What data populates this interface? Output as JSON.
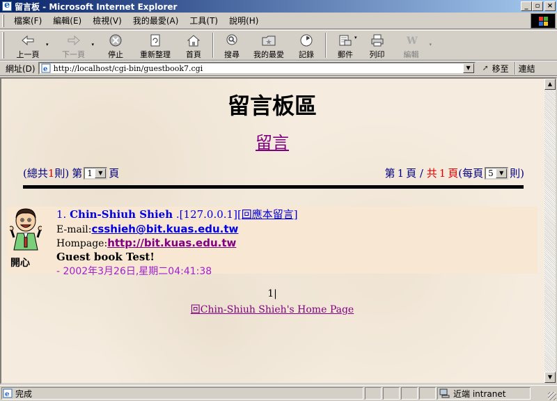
{
  "window": {
    "title": "留言板 - Microsoft Internet Explorer",
    "min_glyph": "_",
    "max_glyph": "▫",
    "close_glyph": "×"
  },
  "menu": [
    "檔案(F)",
    "編輯(E)",
    "檢視(V)",
    "我的最愛(A)",
    "工具(T)",
    "說明(H)"
  ],
  "toolbar": {
    "back": "上一頁",
    "forward": "下一頁",
    "stop": "停止",
    "refresh": "重新整理",
    "home": "首頁",
    "search": "搜尋",
    "favorites": "我的最愛",
    "history": "記錄",
    "mail": "郵件",
    "print": "列印",
    "edit": "編輯",
    "dropdown_glyph": "▾"
  },
  "address": {
    "label": "網址(D)",
    "url": "http://localhost/cgi-bin/guestbook7.cgi",
    "go": "移至",
    "links": "連結",
    "dropdown_glyph": "▼"
  },
  "page": {
    "heading": "留言板區",
    "post_link": "留言",
    "pager_left": {
      "prefix": "(總共",
      "total": "1",
      "suffix": "則)",
      "page_label": "第",
      "page_value": "1",
      "page_unit": "頁"
    },
    "pager_right": {
      "prefix": "第",
      "current": "1",
      "mid": "頁 / ",
      "total_prefix": "共",
      "total": "1",
      "total_unit": "頁",
      "per_prefix": "(每頁",
      "per_value": "5",
      "per_unit": "則)"
    },
    "entry": {
      "number": "1.",
      "author": "Chin-Shiuh Shieh",
      "ip": ".[127.0.0.1]",
      "reply": "[回應本留言]",
      "email_label": "E-mail:",
      "email": "csshieh@bit.kuas.edu.tw",
      "homepage_label": "Hompage:",
      "homepage": "http://bit.kuas.edu.tw",
      "message": "Guest book Test!",
      "date": "- 2002年3月26日,星期二04:41:38",
      "mood": "開心"
    },
    "page_numbers": "1|",
    "home_link": "回Chin-Shiuh Shieh's Home Page"
  },
  "status": {
    "text": "完成",
    "zone": "近端 intranet"
  },
  "scrollbar": {
    "up_glyph": "▲",
    "down_glyph": "▼"
  },
  "colors": {
    "title_start": "#0a246a",
    "title_end": "#a6caf0",
    "page_bg": "#f5ecdf",
    "entry_bg": "#f7e7d3",
    "link_visited": "#800080",
    "link": "#0000e0",
    "date": "#a020d0"
  }
}
